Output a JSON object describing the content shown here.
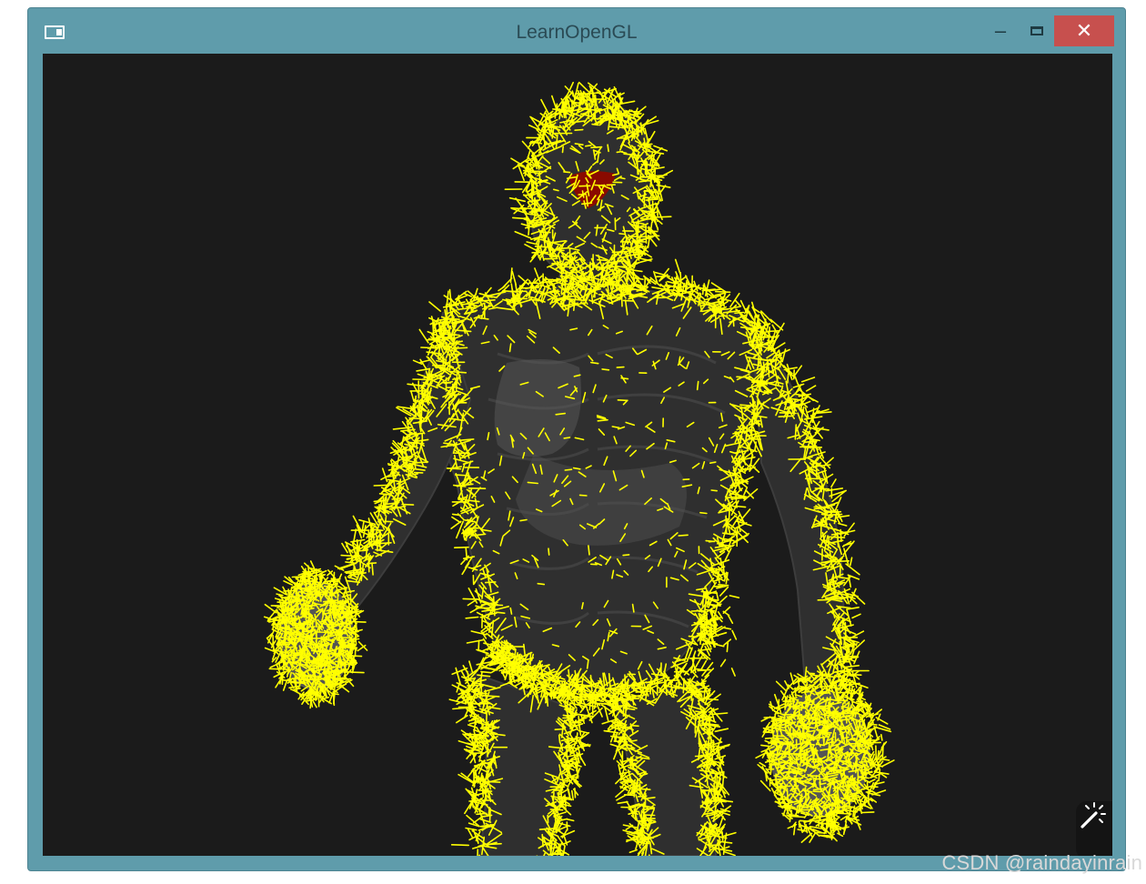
{
  "window": {
    "title": "LearnOpenGL",
    "controls": {
      "minimize": "–",
      "close": "✕"
    },
    "colors": {
      "frame": "#5f9cab",
      "close": "#c7504e",
      "viewport_bg": "#1b1b1b"
    }
  },
  "viewport": {
    "scene": "3d-model-with-normal-visualization",
    "colors": {
      "normals": "#ffff00",
      "model": "#3a3a3a",
      "mouth": "#8a0a00"
    }
  },
  "overlay": {
    "icon": "magic-wand-icon",
    "watermark": "CSDN @raindayinrain"
  }
}
